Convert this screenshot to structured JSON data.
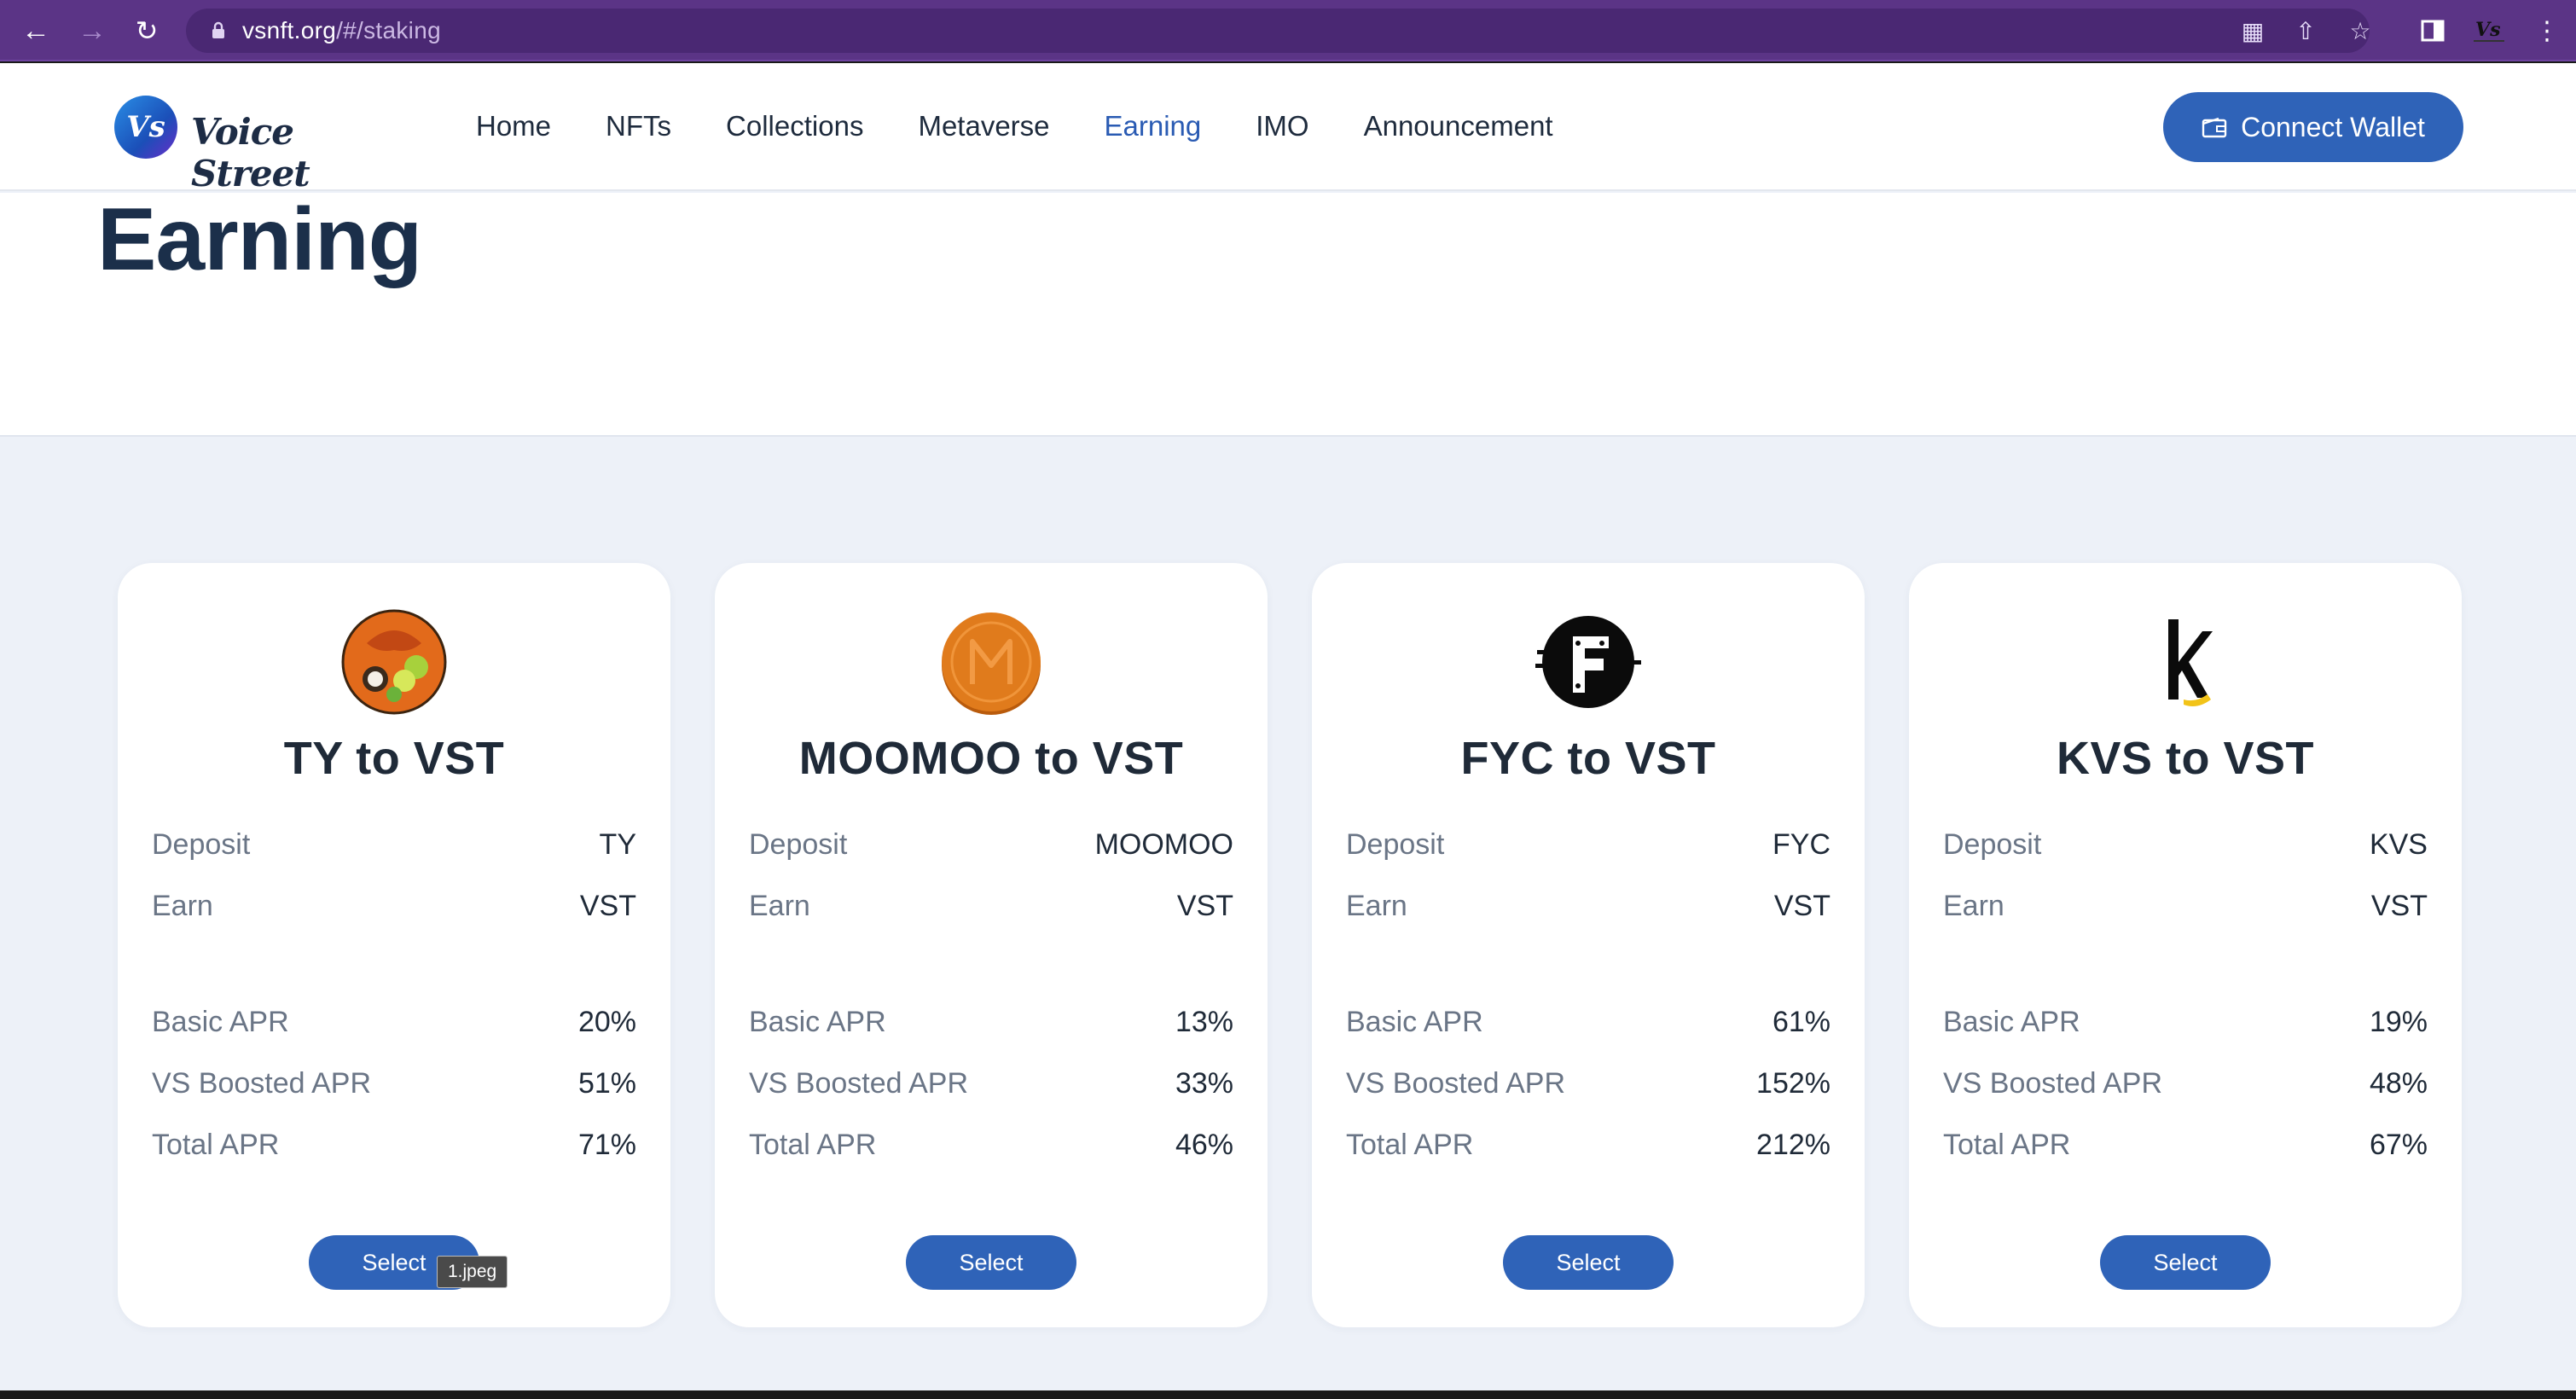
{
  "browser": {
    "url_host": "vsnft.org",
    "url_path": "/#/staking"
  },
  "header": {
    "logo_text": "Voice Street",
    "logo_badge": "Vs",
    "menu": [
      "Home",
      "NFTs",
      "Collections",
      "Metaverse",
      "Earning",
      "IMO",
      "Announcement"
    ],
    "active_menu": "Earning",
    "connect_label": "Connect Wallet"
  },
  "page": {
    "title": "Earning"
  },
  "labels": {
    "deposit": "Deposit",
    "earn": "Earn",
    "basic_apr": "Basic APR",
    "boosted_apr": "VS Boosted APR",
    "total_apr": "Total APR",
    "select": "Select"
  },
  "cards": [
    {
      "title": "TY to VST",
      "deposit": "TY",
      "earn": "VST",
      "basic_apr": "20%",
      "boosted_apr": "51%",
      "total_apr": "71%",
      "icon": "ty-token-icon"
    },
    {
      "title": "MOOMOO to VST",
      "deposit": "MOOMOO",
      "earn": "VST",
      "basic_apr": "13%",
      "boosted_apr": "33%",
      "total_apr": "46%",
      "icon": "moomoo-token-icon"
    },
    {
      "title": "FYC to VST",
      "deposit": "FYC",
      "earn": "VST",
      "basic_apr": "61%",
      "boosted_apr": "152%",
      "total_apr": "212%",
      "icon": "fyc-token-icon"
    },
    {
      "title": "KVS to VST",
      "deposit": "KVS",
      "earn": "VST",
      "basic_apr": "19%",
      "boosted_apr": "48%",
      "total_apr": "67%",
      "icon": "kvs-token-icon"
    }
  ],
  "tooltip": "1.jpeg",
  "colors": {
    "chrome": "#5b3486",
    "primary": "#2f63b8",
    "page_bg": "#edf1f8",
    "title": "#1b2f4a"
  }
}
